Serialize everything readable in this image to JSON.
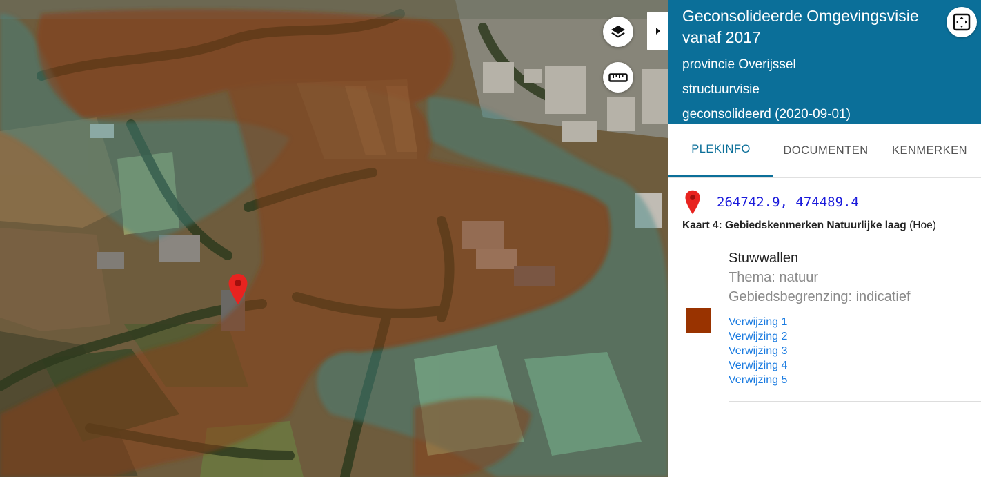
{
  "panel": {
    "title": "Geconsolideerde Omgevingsvisie vanaf 2017",
    "province": "provincie Overijssel",
    "type": "structuurvisie",
    "status": "geconsolideerd (2020-09-01)"
  },
  "tabs": [
    {
      "label": "PLEKINFO",
      "active": true
    },
    {
      "label": "DOCUMENTEN",
      "active": false
    },
    {
      "label": "KENMERKEN",
      "active": false
    }
  ],
  "location": {
    "coordinates": "264742.9, 474489.4"
  },
  "layer": {
    "title": "Kaart 4: Gebiedskenmerken Natuurlijke laag",
    "title_suffix": "(Hoe)"
  },
  "legend": {
    "feature_name": "Stuwwallen",
    "thema": "Thema: natuur",
    "begrenzing": "Gebiedsbegrenzing: indicatief",
    "swatch_color": "#993300",
    "references": [
      "Verwijzing 1",
      "Verwijzing 2",
      "Verwijzing 3",
      "Verwijzing 4",
      "Verwijzing 5"
    ]
  },
  "map": {
    "icons": [
      "layers-icon",
      "ruler-icon",
      "chevron-right-icon",
      "fullscreen-icon",
      "map-marker-icon"
    ],
    "overlay_colors": {
      "stuwwallen": "#8a3d12",
      "other_zone": "#3d8a8a"
    },
    "marker_color": "#e8231f"
  }
}
